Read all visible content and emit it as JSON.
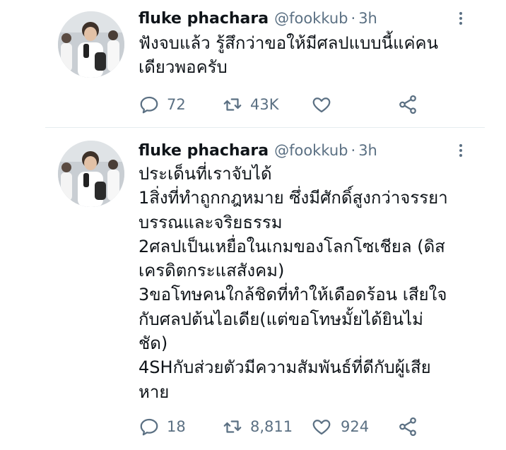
{
  "tweets": [
    {
      "name": "fluke phachara",
      "handle": "@fookkub",
      "separator": "·",
      "time": "3h",
      "text": "ฟังจบแล้ว รู้สึกว่าขอให้มีศลปแบบนี้แค่คน\nเดียวพอครับ",
      "replies": "72",
      "retweets": "43K",
      "likes": ""
    },
    {
      "name": "fluke phachara",
      "handle": "@fookkub",
      "separator": "·",
      "time": "3h",
      "text": "ประเด็นที่เราจับได้\n1สิ่งที่ทำถูกกฎหมาย ซึ่งมีศักดิ์สูงกว่าจรรยา\nบรรณและจริยธรรม\n2ศลปเป็นเหยื่อในเกมของโลกโซเชียล (ดิส\nเครดิตกระแสสังคม)\n3ขอโทษคนใกล้ชิดที่ทำให้เดือดร้อน เสียใจ\nกับศลปต้นไอเดีย(แต่ขอโทษมั้ยได้ยินไม่\nชัด)\n4SHกับส่วยตัวมีความสัมพันธ์ที่ดีกับผู้เสีย\nหาย",
      "replies": "18",
      "retweets": "8,811",
      "likes": "924"
    }
  ]
}
